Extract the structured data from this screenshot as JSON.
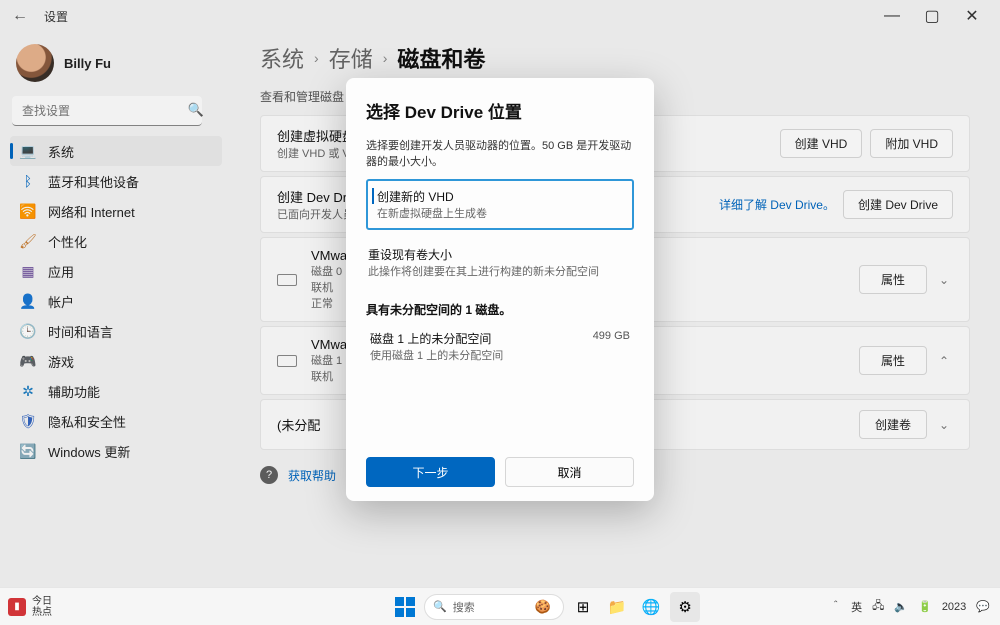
{
  "window": {
    "app_title": "设置",
    "controls": {
      "min": "—",
      "max": "▢",
      "close": "✕",
      "back": "←"
    }
  },
  "user": {
    "name": "Billy Fu"
  },
  "search": {
    "placeholder": "查找设置",
    "icon": "🔍"
  },
  "sidebar": {
    "items": [
      {
        "label": "系统",
        "icon": "💻"
      },
      {
        "label": "蓝牙和其他设备",
        "icon": "ᛒ"
      },
      {
        "label": "网络和 Internet",
        "icon": "🛜"
      },
      {
        "label": "个性化",
        "icon": "🖌"
      },
      {
        "label": "应用",
        "icon": "▦"
      },
      {
        "label": "帐户",
        "icon": "👤"
      },
      {
        "label": "时间和语言",
        "icon": "🕒"
      },
      {
        "label": "游戏",
        "icon": "🎮"
      },
      {
        "label": "辅助功能",
        "icon": "✲"
      },
      {
        "label": "隐私和安全性",
        "icon": "🛡"
      },
      {
        "label": "Windows 更新",
        "icon": "🔄"
      }
    ]
  },
  "breadcrumb": {
    "seg1": "系统",
    "seg2": "存储",
    "current": "磁盘和卷"
  },
  "subheader": "查看和管理磁盘",
  "cards": {
    "vhd": {
      "title": "创建虚拟硬盘",
      "sub": "创建 VHD 或 VH",
      "btn1": "创建 VHD",
      "btn2": "附加 VHD"
    },
    "devdrive": {
      "title": "创建 Dev Driv",
      "sub": "已面向开发人员",
      "link": "详细了解 Dev Drive。",
      "btn": "创建 Dev Drive"
    },
    "disk1": {
      "title": "VMwar",
      "line1": "磁盘 0",
      "line2": "联机",
      "line3": "正常",
      "btn": "属性"
    },
    "disk2": {
      "title": "VMwar",
      "line1": "磁盘 1",
      "line2": "联机",
      "btn": "属性"
    },
    "unalloc": {
      "title": "(未分配",
      "btn": "创建卷"
    }
  },
  "help": {
    "label": "获取帮助"
  },
  "modal": {
    "title": "选择 Dev Drive 位置",
    "desc": "选择要创建开发人员驱动器的位置。50 GB 是开发驱动器的最小大小。",
    "opt1": {
      "title": "创建新的 VHD",
      "desc": "在新虚拟硬盘上生成卷"
    },
    "opt2": {
      "title": "重设现有卷大小",
      "desc": "此操作将创建要在其上进行构建的新未分配空间"
    },
    "section": "具有未分配空间的 1 磁盘。",
    "disk": {
      "title": "磁盘 1 上的未分配空间",
      "desc": "使用磁盘 1 上的未分配空间",
      "size": "499 GB"
    },
    "primary": "下一步",
    "cancel": "取消"
  },
  "taskbar": {
    "widget": {
      "line1": "今日",
      "line2": "热点"
    },
    "search_label": "搜索",
    "lang": "英",
    "year": "2023",
    "chevron": "＾"
  }
}
